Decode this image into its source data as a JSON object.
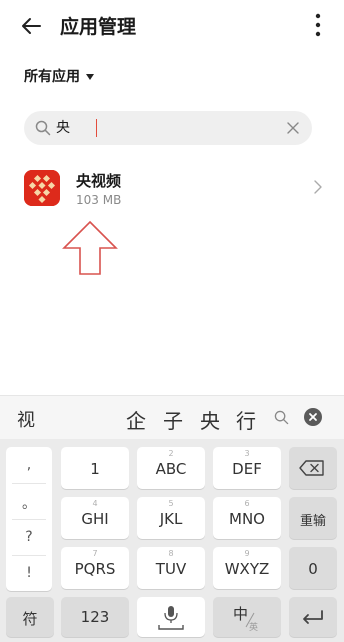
{
  "header": {
    "title": "应用管理"
  },
  "filter": {
    "label": "所有应用"
  },
  "search": {
    "value": "央"
  },
  "app": {
    "name": "央视频",
    "size": "103 MB"
  },
  "candidates": {
    "left": "视",
    "items": [
      "企",
      "子",
      "央",
      "行"
    ]
  },
  "keyboard": {
    "symbols": [
      ",",
      "。",
      "?",
      "!"
    ],
    "rows": [
      [
        {
          "num": "",
          "label": "1"
        },
        {
          "num": "2",
          "label": "ABC"
        },
        {
          "num": "3",
          "label": "DEF"
        }
      ],
      [
        {
          "num": "4",
          "label": "GHI"
        },
        {
          "num": "5",
          "label": "JKL"
        },
        {
          "num": "6",
          "label": "MNO"
        }
      ],
      [
        {
          "num": "7",
          "label": "PQRS"
        },
        {
          "num": "8",
          "label": "TUV"
        },
        {
          "num": "9",
          "label": "WXYZ"
        }
      ]
    ],
    "reenter_label": "重输",
    "zero_label": "0",
    "symbol_key_label": "符",
    "numeric_key_label": "123",
    "lang_main": "中",
    "lang_sub": "英"
  },
  "colors": {
    "app_icon": "#dd2a1b",
    "annotation_arrow": "#d9534f",
    "cursor": "#e34c3c"
  }
}
